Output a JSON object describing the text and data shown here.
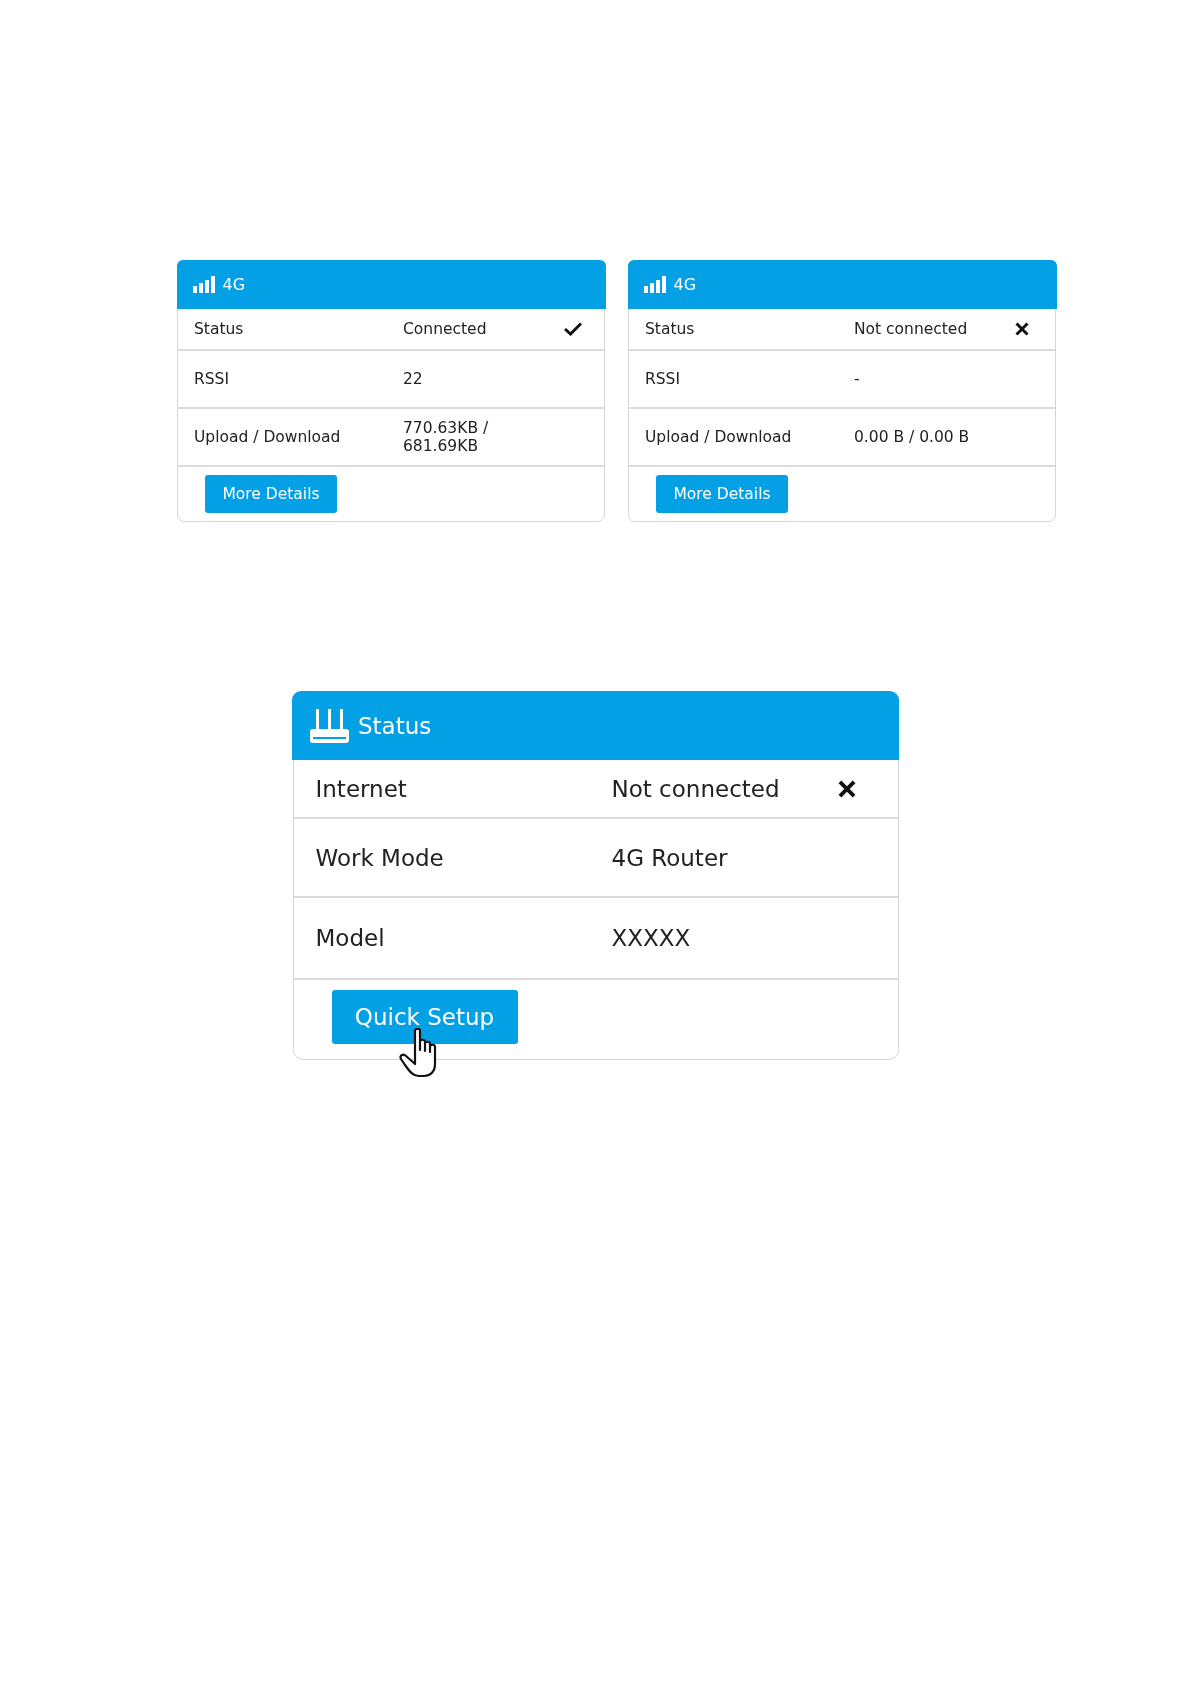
{
  "network_cards": [
    {
      "title": "4G",
      "rows": [
        {
          "label": "Status",
          "value": "Connected",
          "connected": true
        },
        {
          "label": "RSSI",
          "value": "22"
        },
        {
          "label": "Upload / Download",
          "value": "770.63KB / 681.69KB"
        }
      ],
      "button": "More Details"
    },
    {
      "title": "4G",
      "rows": [
        {
          "label": "Status",
          "value": "Not connected",
          "connected": false
        },
        {
          "label": "RSSI",
          "value": "-"
        },
        {
          "label": "Upload / Download",
          "value": "0.00 B / 0.00 B"
        }
      ],
      "button": "More Details"
    }
  ],
  "status_card": {
    "title": "Status",
    "rows": [
      {
        "label": "Internet",
        "value": "Not connected",
        "connected": false
      },
      {
        "label": "Work Mode",
        "value": "4G Router"
      },
      {
        "label": "Model",
        "value": "XXXXX"
      }
    ],
    "button": "Quick Setup"
  }
}
